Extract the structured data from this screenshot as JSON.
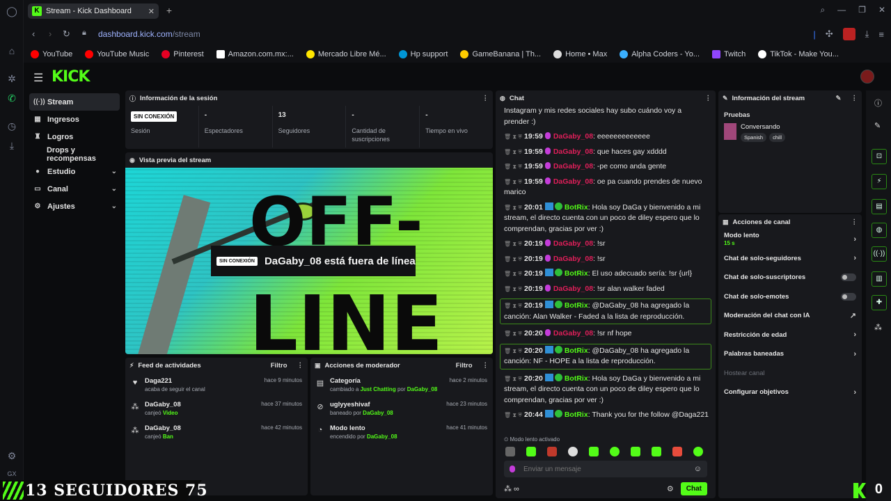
{
  "browser": {
    "tab_title": "Stream - Kick Dashboard",
    "url_host": "dashboard.kick.com",
    "url_path": "/stream",
    "bookmarks": [
      {
        "label": "YouTube",
        "color": "#ff0000"
      },
      {
        "label": "YouTube Music",
        "color": "#ff0000"
      },
      {
        "label": "Pinterest",
        "color": "#e60023"
      },
      {
        "label": "Amazon.com.mx:...",
        "color": "#ffffff"
      },
      {
        "label": "Mercado Libre Mé...",
        "color": "#ffe600"
      },
      {
        "label": "Hp support",
        "color": "#0096d6"
      },
      {
        "label": "GameBanana | Th...",
        "color": "#ffcc00"
      },
      {
        "label": "Home • Max",
        "color": "#dddddd"
      },
      {
        "label": "Alpha Coders - Yo...",
        "color": "#3ab0ff"
      },
      {
        "label": "Twitch",
        "color": "#9146ff"
      },
      {
        "label": "TikTok - Make You...",
        "color": "#ffffff"
      }
    ]
  },
  "sidebar": {
    "items": [
      {
        "label": "Stream",
        "icon": "broadcast-icon"
      },
      {
        "label": "Ingresos",
        "icon": "money-icon"
      },
      {
        "label": "Logros",
        "icon": "trophy-icon"
      },
      {
        "label": "Drops y recompensas",
        "icon": "gift-icon"
      },
      {
        "label": "Estudio",
        "icon": "studio-icon"
      },
      {
        "label": "Canal",
        "icon": "channel-icon"
      },
      {
        "label": "Ajustes",
        "icon": "gear-icon"
      }
    ]
  },
  "session": {
    "title": "Información de la sesión",
    "status_badge": "SIN CONEXIÓN",
    "stats": [
      {
        "value": "",
        "label": "Sesión"
      },
      {
        "value": "-",
        "label": "Espectadores"
      },
      {
        "value": "13",
        "label": "Seguidores"
      },
      {
        "value": "-",
        "label": "Cantidad de suscripciones"
      },
      {
        "value": "-",
        "label": "Tiempo en vivo"
      }
    ]
  },
  "preview": {
    "title": "Vista previa del stream",
    "badge": "SIN CONEXIÓN",
    "message": "DaGaby_08 está fuera de línea",
    "bg_text_1": "OFF-",
    "bg_text_2": "LINE"
  },
  "activity": {
    "title": "Feed de actividades",
    "filter": "Filtro",
    "rows": [
      {
        "icon": "heart-icon",
        "name": "Daga221",
        "sub": "acaba de seguir el canal",
        "highlight": "",
        "time": "hace 9 minutos"
      },
      {
        "icon": "kick-points-icon",
        "name": "DaGaby_08",
        "sub": "canjeó",
        "highlight": "Video",
        "time": "hace 37 minutos"
      },
      {
        "icon": "kick-points-icon",
        "name": "DaGaby_08",
        "sub": "canjeó",
        "highlight": "Ban",
        "time": "hace 42 minutos"
      }
    ]
  },
  "modactions": {
    "title": "Acciones de moderador",
    "filter": "Filtro",
    "rows": [
      {
        "icon": "category-icon",
        "name": "Categoría",
        "sub": "cambiado a",
        "highlight": "Just Chatting",
        "by": "por",
        "who": "DaGaby_08",
        "time": "hace 2 minutos"
      },
      {
        "icon": "ban-icon",
        "name": "uglyyeshivaf",
        "sub": "baneado por",
        "highlight": "",
        "by": "",
        "who": "DaGaby_08",
        "time": "hace 23 minutos"
      },
      {
        "icon": "slow-mode-icon",
        "name": "Modo lento",
        "sub": "encendido por",
        "highlight": "",
        "by": "",
        "who": "DaGaby_08",
        "time": "hace 41 minutos"
      }
    ]
  },
  "chat": {
    "title": "Chat",
    "messages": [
      {
        "time": "",
        "user": "",
        "text": "Instagram y mis redes sociales hay subo cuándo voy a prender :)",
        "type": "cont"
      },
      {
        "time": "19:59",
        "user": "DaGaby_08",
        "text": ": eeeeeeeeeeeee",
        "type": "host"
      },
      {
        "time": "19:59",
        "user": "DaGaby_08",
        "text": ": que haces gay xdddd",
        "type": "host"
      },
      {
        "time": "19:59",
        "user": "DaGaby_08",
        "text": ": -pe como anda gente",
        "type": "host"
      },
      {
        "time": "19:59",
        "user": "DaGaby_08",
        "text": ": oe pa cuando prendes de nuevo marico",
        "type": "host"
      },
      {
        "time": "20:01",
        "user": "BotRix",
        "text": ": Hola soy DaGa y bienvenido a mi stream, el directo cuenta con un poco de diley espero que lo comprendan, gracias por ver :)",
        "type": "bot"
      },
      {
        "time": "20:19",
        "user": "DaGaby_08",
        "text": ": !sr",
        "type": "host"
      },
      {
        "time": "20:19",
        "user": "DaGaby_08",
        "text": ": !sr",
        "type": "host"
      },
      {
        "time": "20:19",
        "user": "BotRix",
        "text": ": El uso adecuado sería: !sr {url}",
        "type": "bot"
      },
      {
        "time": "20:19",
        "user": "DaGaby_08",
        "text": ": !sr alan walker faded",
        "type": "host"
      },
      {
        "time": "20:19",
        "user": "BotRix",
        "text": ": @DaGaby_08 ha agregado la canción: Alan Walker - Faded a la lista de reproducción.",
        "type": "bot-hl"
      },
      {
        "time": "20:20",
        "user": "DaGaby_08",
        "text": ": !sr nf hope",
        "type": "host"
      },
      {
        "time": "20:20",
        "user": "BotRix",
        "text": ": @DaGaby_08 ha agregado la canción: NF - HOPE a la lista de reproducción.",
        "type": "bot-hl"
      },
      {
        "time": "20:20",
        "user": "BotRix",
        "text": ": Hola soy DaGa y bienvenido a mi stream, el directo cuenta con un poco de diley espero que lo comprendan, gracias por ver :)",
        "type": "bot"
      },
      {
        "time": "20:44",
        "user": "BotRix",
        "text": ": Thank you for the follow @Daga221",
        "type": "bot"
      }
    ],
    "slow_mode_note": "Modo lento activado",
    "input_placeholder": "Enviar un mensaje",
    "send_label": "Chat"
  },
  "stream_info": {
    "title": "Información del stream",
    "stream_title": "Pruebas",
    "category": "Conversando",
    "tags": [
      "Spanish",
      "chill"
    ]
  },
  "channel_actions": {
    "title": "Acciones de canal",
    "rows": [
      {
        "label": "Modo lento",
        "sub": "15 s",
        "control": "chevron"
      },
      {
        "label": "Chat de solo-seguidores",
        "sub": "",
        "control": "chevron"
      },
      {
        "label": "Chat de solo-suscriptores",
        "sub": "",
        "control": "toggle"
      },
      {
        "label": "Chat de solo-emotes",
        "sub": "",
        "control": "toggle"
      },
      {
        "label": "Moderación del chat con IA",
        "sub": "",
        "control": "external"
      },
      {
        "label": "Restricción de edad",
        "sub": "",
        "control": "chevron"
      },
      {
        "label": "Palabras baneadas",
        "sub": "",
        "control": "chevron"
      },
      {
        "label": "Hostear canal",
        "sub": "",
        "control": "disabled"
      },
      {
        "label": "Configurar objetivos",
        "sub": "",
        "control": "chevron"
      }
    ]
  },
  "overlay": {
    "followers_text": "13  SEGUIDORES  75",
    "corner_count": "0"
  },
  "colors": {
    "accent": "#53fc18",
    "host_name": "#e01f5a"
  }
}
